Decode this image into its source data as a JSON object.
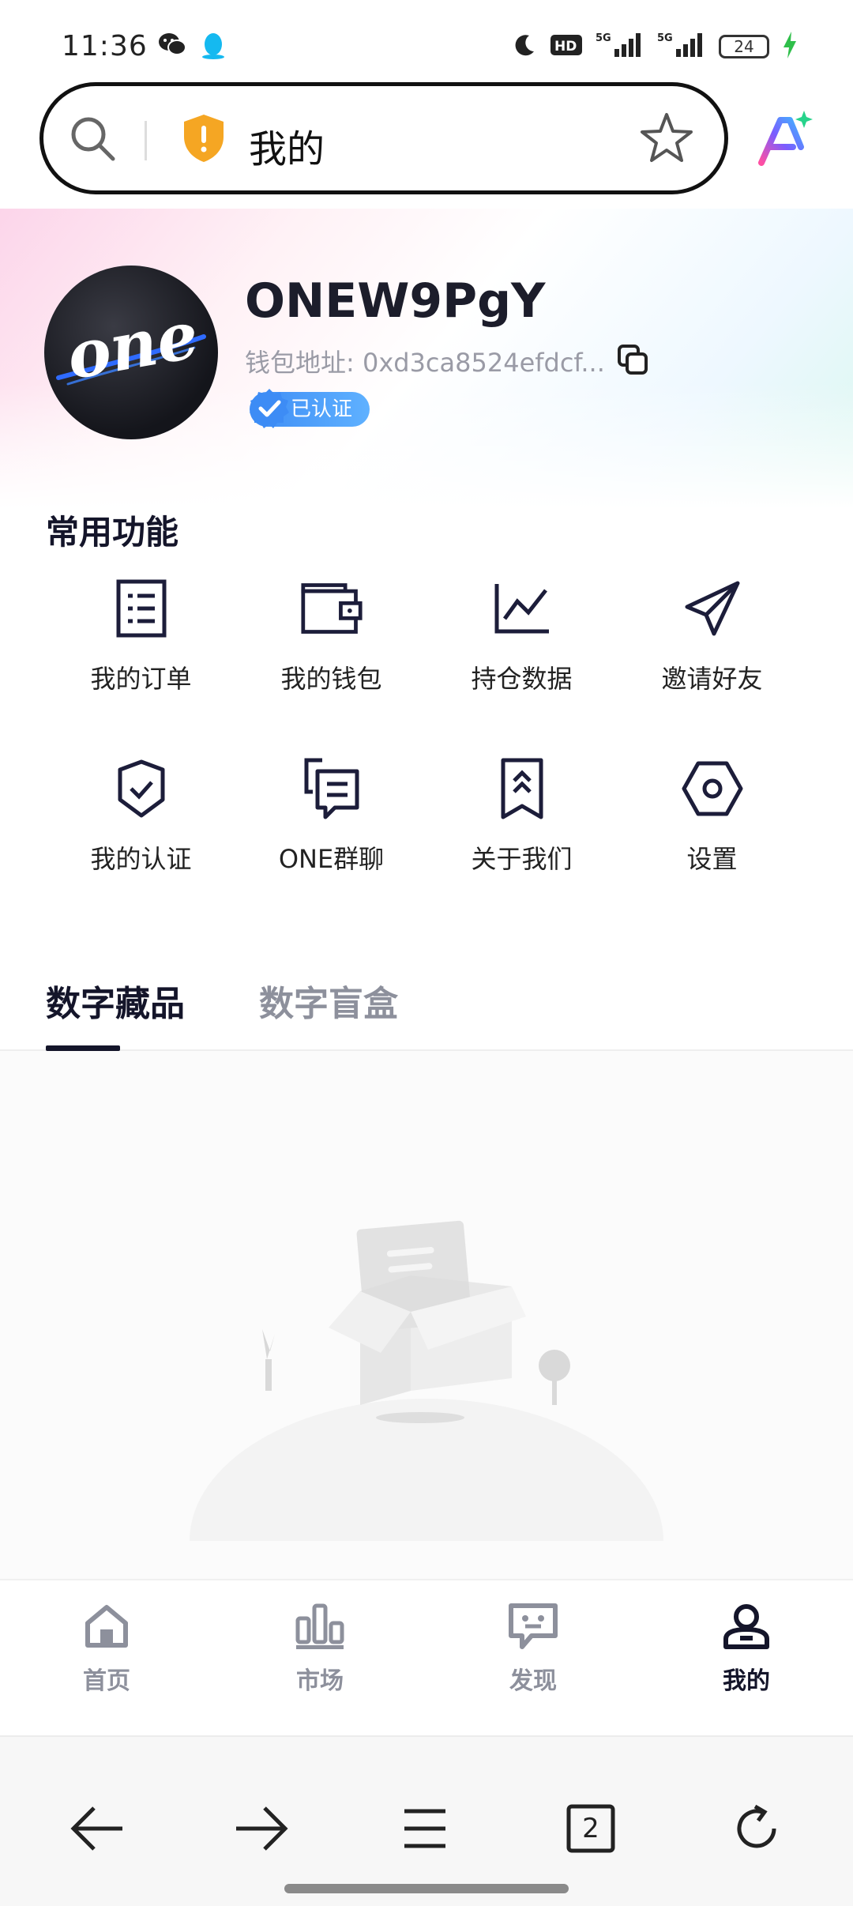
{
  "status_bar": {
    "time": "11:36",
    "app_icons": [
      "wechat-icon",
      "qq-icon"
    ],
    "indicators": [
      "moon-icon",
      "hd-icon",
      "signal-5g-icon",
      "signal-5g-icon"
    ],
    "battery": "24"
  },
  "browser": {
    "address_text": "我的",
    "icons": [
      "search-icon",
      "security-shield-icon",
      "star-icon",
      "ai-assistant-icon"
    ],
    "toolbar": {
      "tab_count": "2",
      "icons": [
        "back-arrow-icon",
        "forward-arrow-icon",
        "menu-icon",
        "tabs-icon",
        "refresh-icon"
      ]
    }
  },
  "profile": {
    "avatar_logo": "one",
    "username": "ONEW9PgY",
    "wallet_label": "钱包地址: 0xd3ca8524efdcf...",
    "verified_label": "已认证"
  },
  "common_functions": {
    "title": "常用功能",
    "items": [
      {
        "label": "我的订单",
        "icon": "order-list-icon"
      },
      {
        "label": "我的钱包",
        "icon": "wallet-icon"
      },
      {
        "label": "持仓数据",
        "icon": "chart-line-icon"
      },
      {
        "label": "邀请好友",
        "icon": "paper-plane-icon"
      },
      {
        "label": "我的认证",
        "icon": "shield-check-icon"
      },
      {
        "label": "ONE群聊",
        "icon": "group-chat-icon"
      },
      {
        "label": "关于我们",
        "icon": "bookmark-icon"
      },
      {
        "label": "设置",
        "icon": "settings-hexagon-icon"
      }
    ]
  },
  "tabs": {
    "active": "数字藏品",
    "inactive": "数字盲盒"
  },
  "bottom_nav": {
    "items": [
      {
        "label": "首页",
        "icon": "home-icon",
        "active": false
      },
      {
        "label": "市场",
        "icon": "market-bars-icon",
        "active": false
      },
      {
        "label": "发现",
        "icon": "discover-chat-icon",
        "active": false
      },
      {
        "label": "我的",
        "icon": "profile-icon",
        "active": true
      }
    ]
  },
  "colors": {
    "primary_dark": "#14152a",
    "inactive_gray": "#8d909c",
    "verified_blue": "#3d8cf5",
    "shield_yellow": "#f5a623"
  }
}
